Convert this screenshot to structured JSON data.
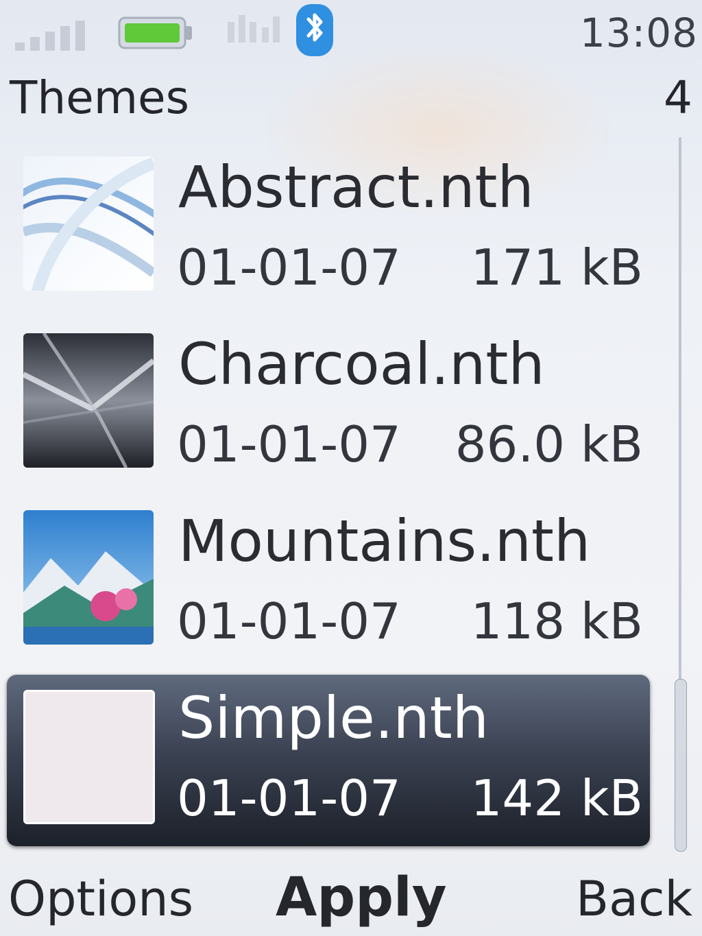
{
  "status_bar": {
    "time": "13:08",
    "icons": [
      "signal-icon",
      "battery-icon",
      "network-icon",
      "bluetooth-icon"
    ]
  },
  "header": {
    "title": "Themes",
    "count": "4"
  },
  "themes": [
    {
      "name": "Abstract.nth",
      "date": "01-01-07",
      "size": "171 kB",
      "selected": false
    },
    {
      "name": "Charcoal.nth",
      "date": "01-01-07",
      "size": "86.0 kB",
      "selected": false
    },
    {
      "name": "Mountains.nth",
      "date": "01-01-07",
      "size": "118 kB",
      "selected": false
    },
    {
      "name": "Simple.nth",
      "date": "01-01-07",
      "size": "142 kB",
      "selected": true
    }
  ],
  "softkeys": {
    "left": "Options",
    "middle": "Apply",
    "right": "Back"
  },
  "colors": {
    "highlight": "#3b4252",
    "battery": "#5fc93a",
    "bluetooth": "#2f8fe0"
  }
}
